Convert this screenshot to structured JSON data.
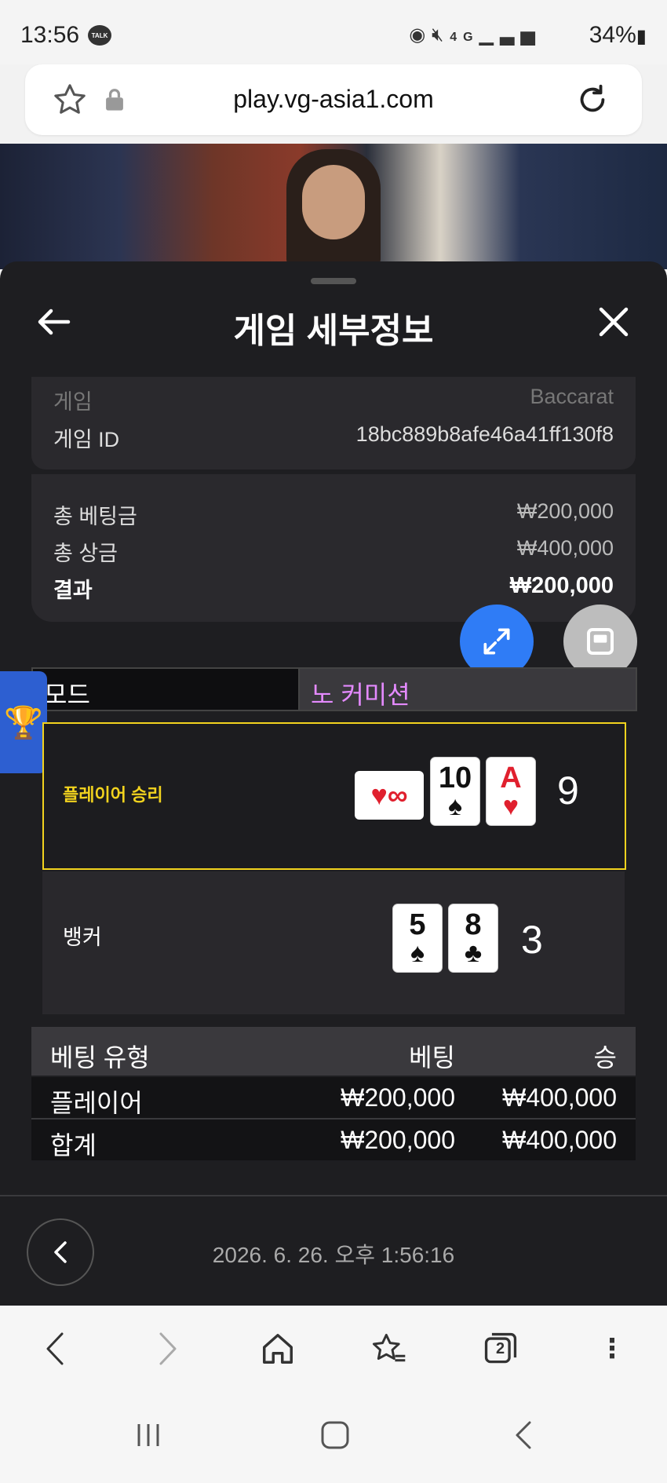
{
  "status": {
    "time": "13:56",
    "talk_badge": "TALK",
    "battery": "34%",
    "network": "4G"
  },
  "browser": {
    "url": "play.vg-asia1.com",
    "tab_count": "2"
  },
  "sheet": {
    "title": "게임 세부정보",
    "game_label": "게임",
    "game_value": "Baccarat",
    "game_id_label": "게임 ID",
    "game_id_value": "18bc889b8afe46a41ff130f8",
    "total_bet_label": "총 베팅금",
    "total_bet_value": "₩200,000",
    "total_prize_label": "총 상금",
    "total_prize_value": "₩400,000",
    "result_label": "결과",
    "result_value": "₩200,000",
    "mode_label": "모드",
    "mode_value": "노 커미션",
    "player_label": "플레이어 승리",
    "player_cards": [
      {
        "rank": "∞",
        "suit": "♥",
        "color": "#e0202e"
      },
      {
        "rank": "10",
        "suit": "♠",
        "color": "#111111"
      },
      {
        "rank": "A",
        "suit": "♥",
        "color": "#e0202e"
      }
    ],
    "player_total": "9",
    "banker_label": "뱅커",
    "banker_cards": [
      {
        "rank": "5",
        "suit": "♠",
        "color": "#111111"
      },
      {
        "rank": "8",
        "suit": "♣",
        "color": "#111111"
      }
    ],
    "banker_total": "3",
    "table_headers": [
      "베팅 유형",
      "베팅",
      "승"
    ],
    "table_rows": [
      [
        "플레이어",
        "₩200,000",
        "₩400,000"
      ],
      [
        "합계",
        "₩200,000",
        "₩400,000"
      ]
    ],
    "timestamp": "2026. 6. 26. 오후 1:56:16"
  },
  "colors": {
    "accent_blue": "#2f7cf6",
    "winner_border": "#f2d31e",
    "mode_text": "#e48aff"
  }
}
